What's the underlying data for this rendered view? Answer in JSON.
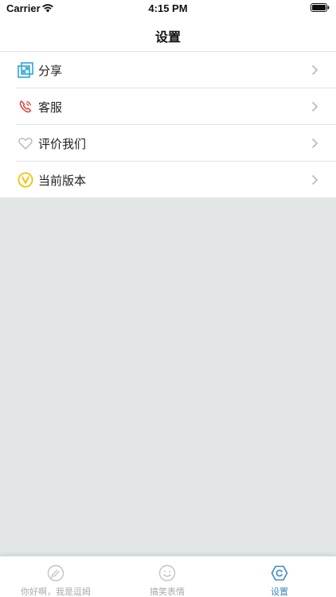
{
  "status_bar": {
    "carrier": "Carrier",
    "time": "4:15 PM"
  },
  "nav": {
    "title": "设置"
  },
  "settings": {
    "items": [
      {
        "label": "分享",
        "icon": "share-icon"
      },
      {
        "label": "客服",
        "icon": "phone-icon"
      },
      {
        "label": "评价我们",
        "icon": "heart-icon"
      },
      {
        "label": "当前版本",
        "icon": "version-icon"
      }
    ]
  },
  "tab_bar": {
    "tabs": [
      {
        "label": "你好啊，我是逗姆",
        "icon": "chat-icon",
        "active": false
      },
      {
        "label": "搞笑表情",
        "icon": "smiley-icon",
        "active": false
      },
      {
        "label": "设置",
        "icon": "settings-hex-icon",
        "active": true
      }
    ]
  },
  "colors": {
    "background": "#e3e6e6",
    "active_tab": "#3a8bc4",
    "inactive_tab": "#aaaaaa",
    "share_icon": "#2ea3d8",
    "phone_icon": "#e0443a",
    "version_icon": "#f2c200"
  }
}
